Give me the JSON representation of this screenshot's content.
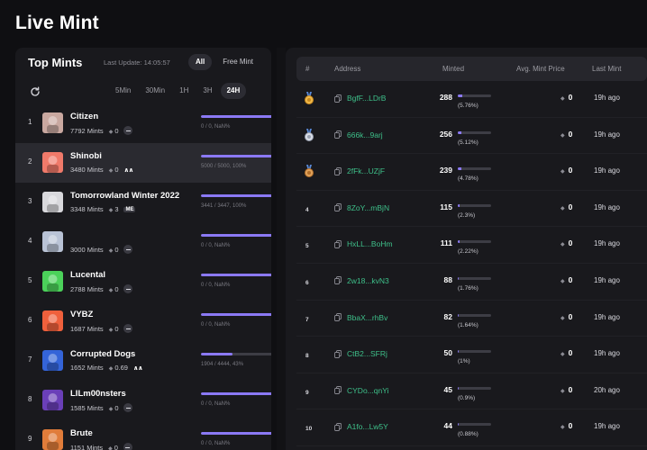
{
  "app": {
    "title": "Live Mint"
  },
  "left": {
    "title": "Top Mints",
    "last_update": "Last Update: 14:05:57",
    "filters": [
      {
        "label": "All",
        "active": true
      },
      {
        "label": "Free Mint",
        "active": false
      }
    ],
    "time_tabs": [
      {
        "label": "5Min",
        "active": false
      },
      {
        "label": "30Min",
        "active": false
      },
      {
        "label": "1H",
        "active": false
      },
      {
        "label": "3H",
        "active": false
      },
      {
        "label": "24H",
        "active": true
      }
    ],
    "mints": [
      {
        "rank": "1",
        "name": "Citizen",
        "mints": "7792 Mints",
        "price": "0",
        "badge": "mp",
        "progress": 1.0,
        "progress_label": "0 / 0, NaN%",
        "selected": false,
        "thumb": "#c9a8a0"
      },
      {
        "rank": "2",
        "name": "Shinobi",
        "mints": "3480 Mints",
        "price": "0",
        "badge": "mk",
        "progress": 1.0,
        "progress_label": "5000 / 5000, 100%",
        "selected": true,
        "thumb": "#f07a6a"
      },
      {
        "rank": "3",
        "name": "Tomorrowland Winter 2022",
        "mints": "3348 Mints",
        "price": "3",
        "badge": "me",
        "progress": 1.0,
        "progress_label": "3441 / 3447, 100%",
        "selected": false,
        "thumb": "#d8d8dc"
      },
      {
        "rank": "4",
        "name": "",
        "mints": "3000 Mints",
        "price": "0",
        "badge": "mp",
        "progress": 1.0,
        "progress_label": "0 / 0, NaN%",
        "selected": false,
        "thumb": "#b9c3d6"
      },
      {
        "rank": "5",
        "name": "Lucental",
        "mints": "2788 Mints",
        "price": "0",
        "badge": "mp",
        "progress": 1.0,
        "progress_label": "0 / 0, NaN%",
        "selected": false,
        "thumb": "#4bd15a"
      },
      {
        "rank": "6",
        "name": "VYBZ",
        "mints": "1687 Mints",
        "price": "0",
        "badge": "mp",
        "progress": 1.0,
        "progress_label": "0 / 0, NaN%",
        "selected": false,
        "thumb": "#f0603c"
      },
      {
        "rank": "7",
        "name": "Corrupted Dogs",
        "mints": "1652 Mints",
        "price": "0.69",
        "badge": "mk",
        "progress": 0.43,
        "progress_label": "1904 / 4444, 43%",
        "selected": false,
        "thumb": "#3464d8"
      },
      {
        "rank": "8",
        "name": "LILm00nsters",
        "mints": "1585 Mints",
        "price": "0",
        "badge": "mp",
        "progress": 1.0,
        "progress_label": "0 / 0, NaN%",
        "selected": false,
        "thumb": "#6a3fb8"
      },
      {
        "rank": "9",
        "name": "Brute",
        "mints": "1151 Mints",
        "price": "0",
        "badge": "mp",
        "progress": 1.0,
        "progress_label": "0 / 0, NaN%",
        "selected": false,
        "thumb": "#e07c3a"
      }
    ]
  },
  "right": {
    "columns": {
      "rank": "#",
      "address": "Address",
      "minted": "Minted",
      "avg_price": "Avg. Mint Price",
      "last_mint": "Last Mint"
    },
    "rows": [
      {
        "rank": "1",
        "medal": "gold",
        "address": "BgfF...LDrB",
        "minted": "288",
        "pct": "(5.76%)",
        "fraction": 0.0576,
        "price": "0",
        "last": "19h ago"
      },
      {
        "rank": "2",
        "medal": "silver",
        "address": "666k...9arj",
        "minted": "256",
        "pct": "(5.12%)",
        "fraction": 0.0512,
        "price": "0",
        "last": "19h ago"
      },
      {
        "rank": "3",
        "medal": "bronze",
        "address": "2fFk...UZjF",
        "minted": "239",
        "pct": "(4.78%)",
        "fraction": 0.0478,
        "price": "0",
        "last": "19h ago"
      },
      {
        "rank": "4",
        "medal": "",
        "address": "8ZoY...mBjN",
        "minted": "115",
        "pct": "(2.3%)",
        "fraction": 0.023,
        "price": "0",
        "last": "19h ago"
      },
      {
        "rank": "5",
        "medal": "",
        "address": "HxLL...BoHm",
        "minted": "111",
        "pct": "(2.22%)",
        "fraction": 0.0222,
        "price": "0",
        "last": "19h ago"
      },
      {
        "rank": "6",
        "medal": "",
        "address": "2w18...kvN3",
        "minted": "88",
        "pct": "(1.76%)",
        "fraction": 0.0176,
        "price": "0",
        "last": "19h ago"
      },
      {
        "rank": "7",
        "medal": "",
        "address": "BbaX...rhBv",
        "minted": "82",
        "pct": "(1.64%)",
        "fraction": 0.0164,
        "price": "0",
        "last": "19h ago"
      },
      {
        "rank": "8",
        "medal": "",
        "address": "CtB2...SFRj",
        "minted": "50",
        "pct": "(1%)",
        "fraction": 0.01,
        "price": "0",
        "last": "19h ago"
      },
      {
        "rank": "9",
        "medal": "",
        "address": "CYDo...qnYi",
        "minted": "45",
        "pct": "(0.9%)",
        "fraction": 0.009,
        "price": "0",
        "last": "20h ago"
      },
      {
        "rank": "10",
        "medal": "",
        "address": "A1fo...Lw5Y",
        "minted": "44",
        "pct": "(0.88%)",
        "fraction": 0.0088,
        "price": "0",
        "last": "19h ago"
      }
    ]
  },
  "colors": {
    "accent": "#8b79f5",
    "address": "#3ec08a",
    "panel": "#19191d",
    "background": "#0f0f12"
  },
  "icons": {
    "refresh": "refresh-icon",
    "copy": "copy-icon",
    "price": "diamond-icon"
  }
}
